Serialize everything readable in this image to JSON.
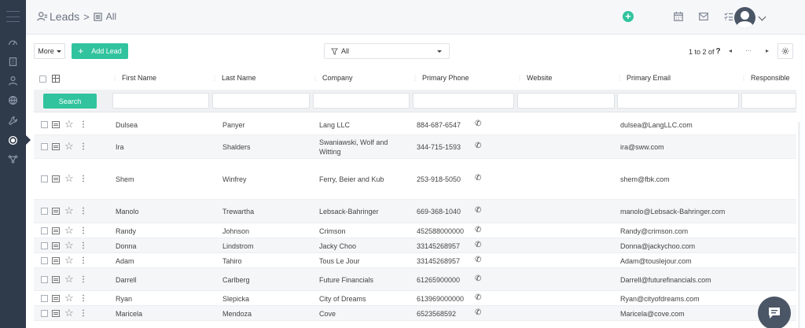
{
  "header": {
    "module": "Leads",
    "separator": ">",
    "view": "All"
  },
  "toolbar": {
    "more_label": "More",
    "add_label": "Add Lead",
    "filter_value": "All",
    "pager_text": "1 to 2  of",
    "pager_unknown": "?",
    "first": "◂",
    "dots": "···",
    "next": "▸"
  },
  "table": {
    "columns": [
      "First Name",
      "Last Name",
      "Company",
      "Primary Phone",
      "Website",
      "Primary Email",
      "Responsible"
    ],
    "search_label": "Search",
    "rows": [
      {
        "first": "Dulsea",
        "last": "Panyer",
        "company": "Lang LLC",
        "phone": "884-687-6547",
        "email": "dulsea@LangLLC.com"
      },
      {
        "first": "Ira",
        "last": "Shalders",
        "company": "Swaniawski, Wolf and Witting",
        "phone": "344-715-1593",
        "email": "ira@sww.com"
      },
      {
        "first": "Shem",
        "last": "Winfrey",
        "company": "Ferry, Beier and Kub",
        "phone": "253-918-5050",
        "email": "shem@fbk.com"
      },
      {
        "first": "Manolo",
        "last": "Trewartha",
        "company": "Lebsack-Bahringer",
        "phone": "669-368-1040",
        "email": "manolo@Lebsack-Bahringer.com"
      },
      {
        "first": "Randy",
        "last": "Johnson",
        "company": "Crimson",
        "phone": "452588000000",
        "email": "Randy@crimson.com"
      },
      {
        "first": "Donna",
        "last": "Lindstrom",
        "company": "Jacky Choo",
        "phone": "33145268957",
        "email": "Donna@jackychoo.com"
      },
      {
        "first": "Adam",
        "last": "Tahiro",
        "company": "Tous Le Jour",
        "phone": "33145268957",
        "email": "Adam@touslejour.com"
      },
      {
        "first": "Darrell",
        "last": "Carlberg",
        "company": "Future Financials",
        "phone": "61265900000",
        "email": "Darrell@futurefinancials.com"
      },
      {
        "first": "Ryan",
        "last": "Slepicka",
        "company": "City of Dreams",
        "phone": "613969000000",
        "email": "Ryan@cityofdreams.com"
      },
      {
        "first": "Maricela",
        "last": "Mendoza",
        "company": "Cove",
        "phone": "6523568592",
        "email": "Maricela@cove.com"
      }
    ]
  },
  "icons": {
    "star": "☆",
    "kebab": "⋮",
    "phone": "✆"
  },
  "colors": {
    "accent": "#30c39e",
    "sidebar": "#2f3a4a"
  }
}
